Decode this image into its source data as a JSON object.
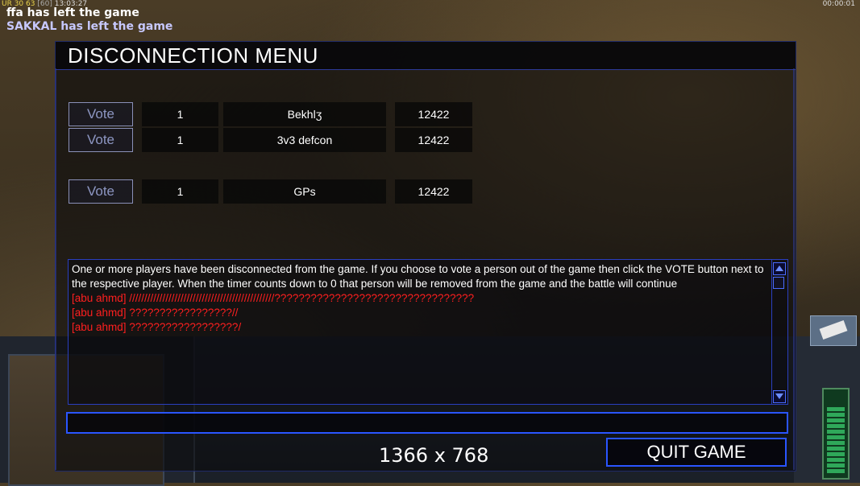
{
  "hud": {
    "stats_a": "UR 30",
    "stats_b": "63",
    "stats_c": "[60]",
    "time_left": "13:03:27",
    "time_right": "00:00:01"
  },
  "chat_overlay": [
    "ffa has left the game",
    "SAKKAL has left the game"
  ],
  "dialog": {
    "title": "DISCONNECTION MENU",
    "vote_label": "Vote",
    "players": [
      {
        "number": "1",
        "name": "Bekhlʒ",
        "value": "12422"
      },
      {
        "number": "1",
        "name": "3v3 defcon",
        "value": "12422"
      },
      {
        "number": "1",
        "name": "GPs",
        "value": "12422"
      }
    ],
    "log_info": "One or more players have been disconnected from the game. If you choose to vote a person out of the game then click the VOTE button next to the respective player. When the timer counts down to 0 that person will be removed from the game and the battle will continue",
    "log_messages": [
      "[abu ahmd] ////////////////////////////////////////////////?????????????????????????????????",
      "[abu ahmd] ?????????????????//",
      "[abu ahmd] ??????????????????/"
    ],
    "chat_input_value": "",
    "quit_label": "QUIT GAME"
  },
  "overlay_label": "1366 x 768",
  "colors": {
    "accent_border": "#2a55ff",
    "enemy_text": "#ff1f1f",
    "vote_text": "#8d96c2"
  }
}
